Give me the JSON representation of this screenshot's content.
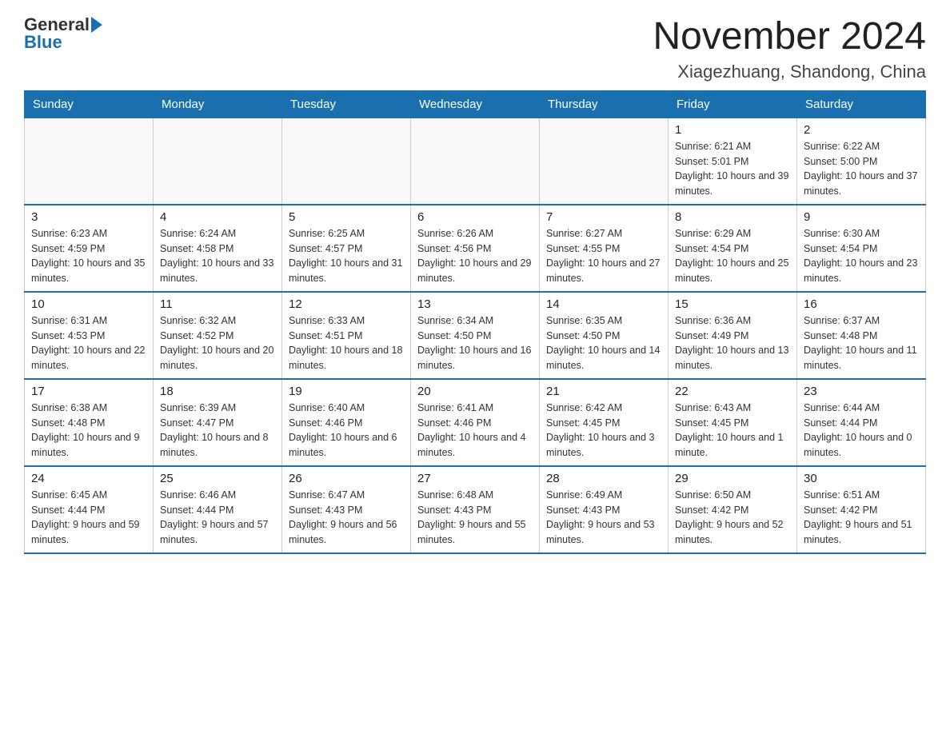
{
  "logo": {
    "general": "General",
    "blue": "Blue"
  },
  "header": {
    "month": "November 2024",
    "location": "Xiagezhuang, Shandong, China"
  },
  "weekdays": [
    "Sunday",
    "Monday",
    "Tuesday",
    "Wednesday",
    "Thursday",
    "Friday",
    "Saturday"
  ],
  "weeks": [
    [
      {
        "day": "",
        "info": ""
      },
      {
        "day": "",
        "info": ""
      },
      {
        "day": "",
        "info": ""
      },
      {
        "day": "",
        "info": ""
      },
      {
        "day": "",
        "info": ""
      },
      {
        "day": "1",
        "info": "Sunrise: 6:21 AM\nSunset: 5:01 PM\nDaylight: 10 hours and 39 minutes."
      },
      {
        "day": "2",
        "info": "Sunrise: 6:22 AM\nSunset: 5:00 PM\nDaylight: 10 hours and 37 minutes."
      }
    ],
    [
      {
        "day": "3",
        "info": "Sunrise: 6:23 AM\nSunset: 4:59 PM\nDaylight: 10 hours and 35 minutes."
      },
      {
        "day": "4",
        "info": "Sunrise: 6:24 AM\nSunset: 4:58 PM\nDaylight: 10 hours and 33 minutes."
      },
      {
        "day": "5",
        "info": "Sunrise: 6:25 AM\nSunset: 4:57 PM\nDaylight: 10 hours and 31 minutes."
      },
      {
        "day": "6",
        "info": "Sunrise: 6:26 AM\nSunset: 4:56 PM\nDaylight: 10 hours and 29 minutes."
      },
      {
        "day": "7",
        "info": "Sunrise: 6:27 AM\nSunset: 4:55 PM\nDaylight: 10 hours and 27 minutes."
      },
      {
        "day": "8",
        "info": "Sunrise: 6:29 AM\nSunset: 4:54 PM\nDaylight: 10 hours and 25 minutes."
      },
      {
        "day": "9",
        "info": "Sunrise: 6:30 AM\nSunset: 4:54 PM\nDaylight: 10 hours and 23 minutes."
      }
    ],
    [
      {
        "day": "10",
        "info": "Sunrise: 6:31 AM\nSunset: 4:53 PM\nDaylight: 10 hours and 22 minutes."
      },
      {
        "day": "11",
        "info": "Sunrise: 6:32 AM\nSunset: 4:52 PM\nDaylight: 10 hours and 20 minutes."
      },
      {
        "day": "12",
        "info": "Sunrise: 6:33 AM\nSunset: 4:51 PM\nDaylight: 10 hours and 18 minutes."
      },
      {
        "day": "13",
        "info": "Sunrise: 6:34 AM\nSunset: 4:50 PM\nDaylight: 10 hours and 16 minutes."
      },
      {
        "day": "14",
        "info": "Sunrise: 6:35 AM\nSunset: 4:50 PM\nDaylight: 10 hours and 14 minutes."
      },
      {
        "day": "15",
        "info": "Sunrise: 6:36 AM\nSunset: 4:49 PM\nDaylight: 10 hours and 13 minutes."
      },
      {
        "day": "16",
        "info": "Sunrise: 6:37 AM\nSunset: 4:48 PM\nDaylight: 10 hours and 11 minutes."
      }
    ],
    [
      {
        "day": "17",
        "info": "Sunrise: 6:38 AM\nSunset: 4:48 PM\nDaylight: 10 hours and 9 minutes."
      },
      {
        "day": "18",
        "info": "Sunrise: 6:39 AM\nSunset: 4:47 PM\nDaylight: 10 hours and 8 minutes."
      },
      {
        "day": "19",
        "info": "Sunrise: 6:40 AM\nSunset: 4:46 PM\nDaylight: 10 hours and 6 minutes."
      },
      {
        "day": "20",
        "info": "Sunrise: 6:41 AM\nSunset: 4:46 PM\nDaylight: 10 hours and 4 minutes."
      },
      {
        "day": "21",
        "info": "Sunrise: 6:42 AM\nSunset: 4:45 PM\nDaylight: 10 hours and 3 minutes."
      },
      {
        "day": "22",
        "info": "Sunrise: 6:43 AM\nSunset: 4:45 PM\nDaylight: 10 hours and 1 minute."
      },
      {
        "day": "23",
        "info": "Sunrise: 6:44 AM\nSunset: 4:44 PM\nDaylight: 10 hours and 0 minutes."
      }
    ],
    [
      {
        "day": "24",
        "info": "Sunrise: 6:45 AM\nSunset: 4:44 PM\nDaylight: 9 hours and 59 minutes."
      },
      {
        "day": "25",
        "info": "Sunrise: 6:46 AM\nSunset: 4:44 PM\nDaylight: 9 hours and 57 minutes."
      },
      {
        "day": "26",
        "info": "Sunrise: 6:47 AM\nSunset: 4:43 PM\nDaylight: 9 hours and 56 minutes."
      },
      {
        "day": "27",
        "info": "Sunrise: 6:48 AM\nSunset: 4:43 PM\nDaylight: 9 hours and 55 minutes."
      },
      {
        "day": "28",
        "info": "Sunrise: 6:49 AM\nSunset: 4:43 PM\nDaylight: 9 hours and 53 minutes."
      },
      {
        "day": "29",
        "info": "Sunrise: 6:50 AM\nSunset: 4:42 PM\nDaylight: 9 hours and 52 minutes."
      },
      {
        "day": "30",
        "info": "Sunrise: 6:51 AM\nSunset: 4:42 PM\nDaylight: 9 hours and 51 minutes."
      }
    ]
  ]
}
